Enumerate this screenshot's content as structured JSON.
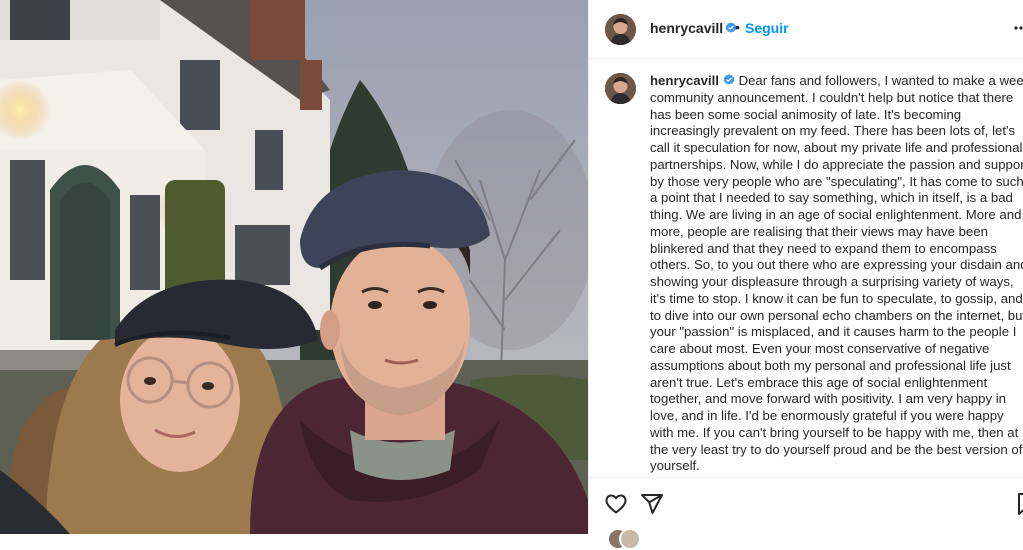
{
  "post": {
    "username": "henrycavill",
    "verified": true,
    "separator": "•",
    "follow_label": "Seguir",
    "caption_text": "Dear fans and followers, I wanted to make a wee community announcement. I couldn't help but notice that there has been some social animosity of late. It's becoming increasingly prevalent on my feed. There has been lots of, let's call it speculation for now, about my private life and professional partnerships. Now, while I do appreciate the passion and support by those very people who are \"speculating\", It has come to such a point that I needed to say something, which in itself, is a bad thing. We are living in an age of social enlightenment. More and more, people are realising that their views may have been blinkered and that they need to expand them to encompass others. So, to you out there who are expressing your disdain and showing your displeasure through a surprising variety of ways, it's time to stop. I know it can be fun to speculate, to gossip, and to dive into our own personal echo chambers on the internet, but your \"passion\" is misplaced, and it causes harm to the people I care about most. Even your most conservative of negative assumptions about both my personal and professional life just aren't true. Let's embrace this age of social enlightenment together, and move forward with positivity. I am very happy in love, and in life. I'd be enormously grateful if you were happy with me. If you can't bring yourself to be happy with me, then at the very least try to do yourself proud and be the best version of yourself."
  },
  "actions": {
    "like_icon": "heart-icon",
    "share_icon": "paper-plane-icon",
    "save_icon": "bookmark-icon"
  },
  "colors": {
    "follow": "#0095f6",
    "verified": "#3897f0",
    "text": "#262626",
    "divider": "#efefef"
  }
}
